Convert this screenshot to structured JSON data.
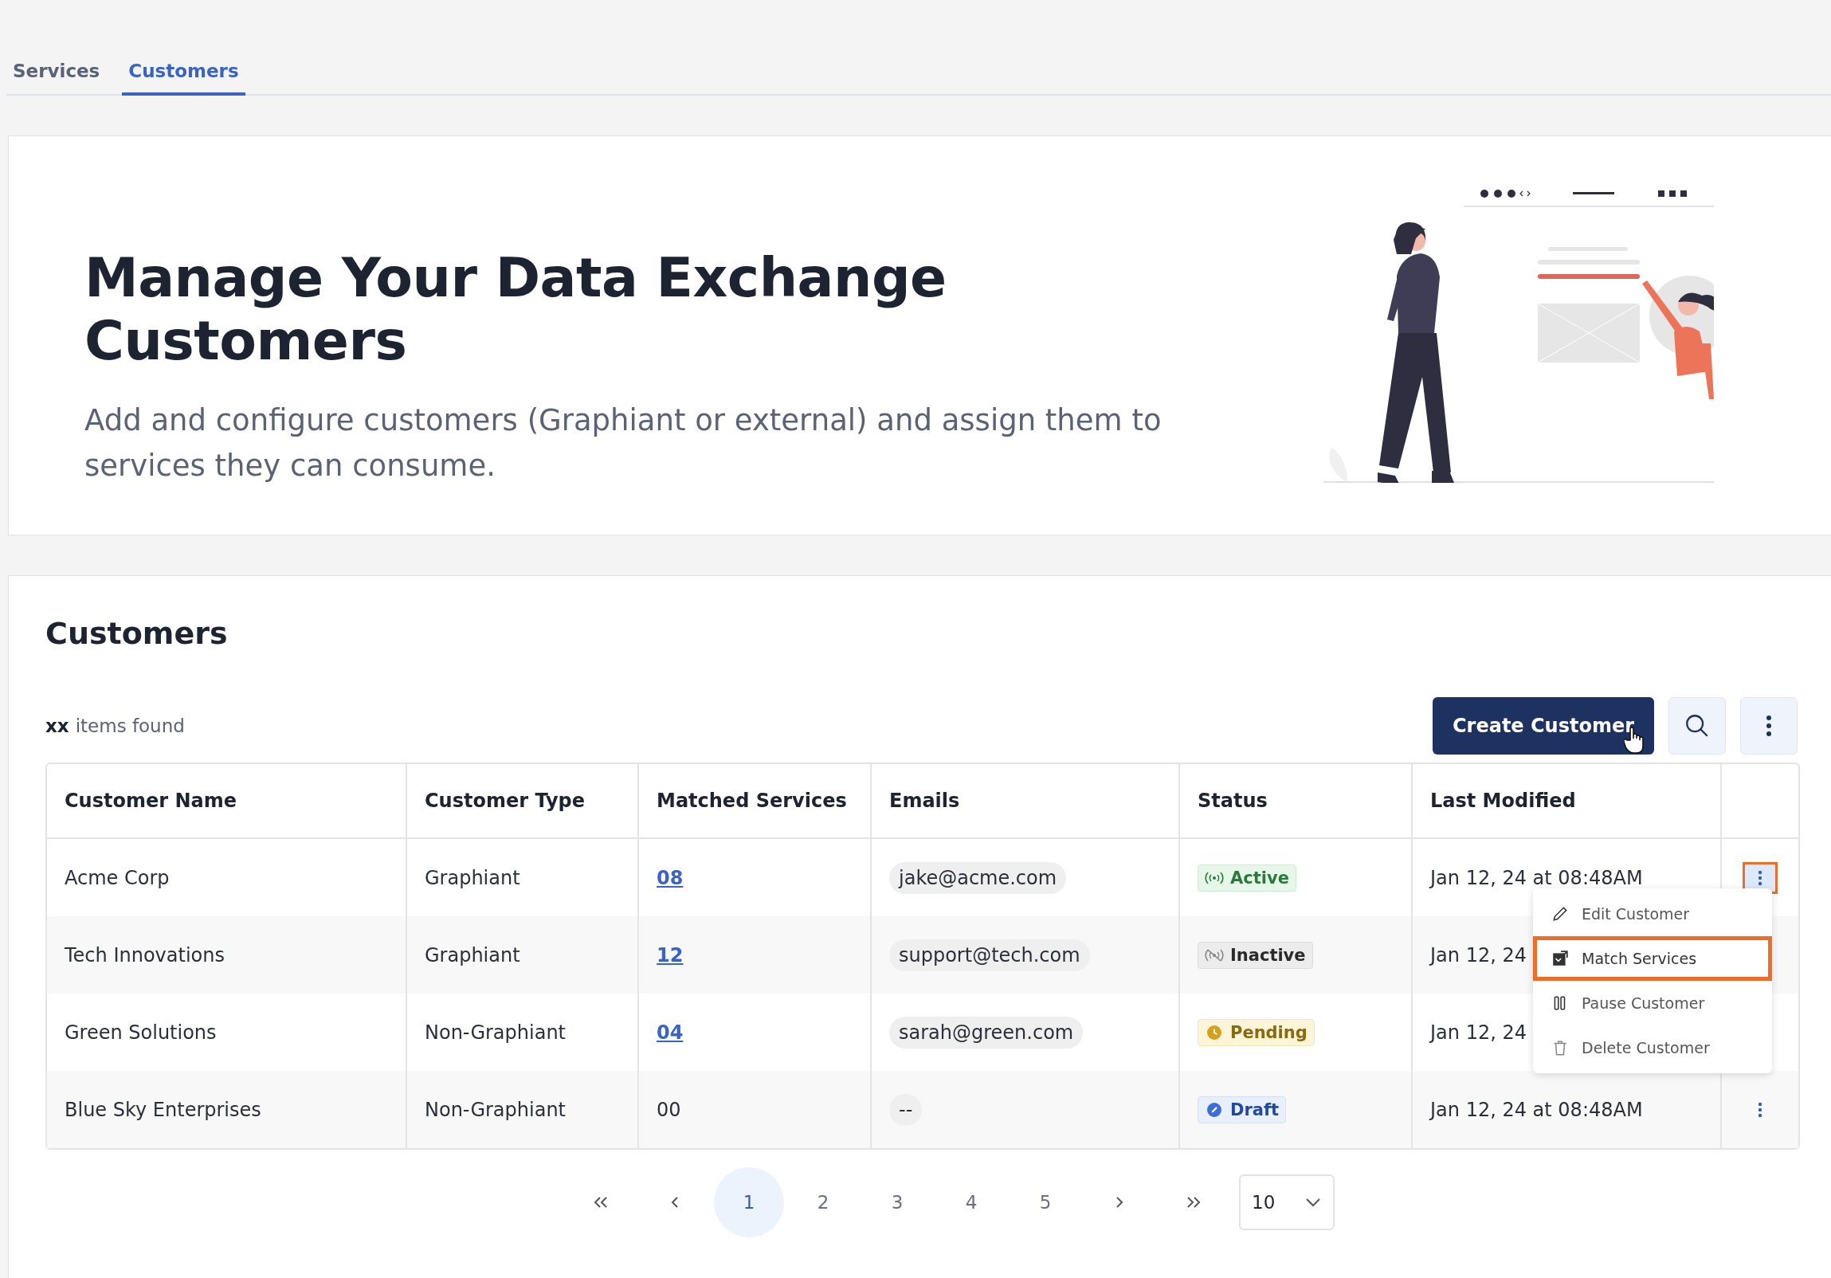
{
  "tabs": [
    {
      "label": "Services",
      "selected": false
    },
    {
      "label": "Customers",
      "selected": true
    }
  ],
  "hero": {
    "title": "Manage Your Data Exchange Customers",
    "subtitle": "Add and configure customers (Graphiant or external) and assign them to services they can consume."
  },
  "customers": {
    "title": "Customers",
    "count": "xx",
    "count_label": "items found",
    "create_button": "Create Customer",
    "columns": [
      "Customer Name",
      "Customer Type",
      "Matched Services",
      "Emails",
      "Status",
      "Last Modified"
    ],
    "rows": [
      {
        "name": "Acme Corp",
        "type": "Graphiant",
        "matched": "08",
        "linked": true,
        "email": "jake@acme.com",
        "status": {
          "label": "Active",
          "kind": "active"
        },
        "modified": "Jan 12, 24 at 08:48AM",
        "menu_open": true
      },
      {
        "name": "Tech Innovations",
        "type": "Graphiant",
        "matched": "12",
        "linked": true,
        "email": "support@tech.com",
        "status": {
          "label": "Inactive",
          "kind": "inactive"
        },
        "modified": "Jan 12, 24"
      },
      {
        "name": "Green Solutions",
        "type": "Non-Graphiant",
        "matched": "04",
        "linked": true,
        "email": "sarah@green.com",
        "status": {
          "label": "Pending",
          "kind": "pending"
        },
        "modified": "Jan 12, 24"
      },
      {
        "name": "Blue Sky Enterprises",
        "type": "Non-Graphiant",
        "matched": "00",
        "linked": false,
        "email": "--",
        "status": {
          "label": "Draft",
          "kind": "draft"
        },
        "modified": "Jan 12, 24 at 08:48AM",
        "menu_open": false
      }
    ],
    "row_menu": [
      {
        "label": "Edit Customer",
        "kind": "edit",
        "selected": false
      },
      {
        "label": "Match Services",
        "kind": "match",
        "selected": true
      },
      {
        "label": "Pause Customer",
        "kind": "pause",
        "selected": false
      },
      {
        "label": "Delete Customer",
        "kind": "delete",
        "selected": false
      }
    ],
    "pagination": {
      "pages": [
        {
          "label": "1",
          "selected": true
        },
        {
          "label": "2",
          "selected": false
        },
        {
          "label": "3",
          "selected": false
        },
        {
          "label": "4",
          "selected": false
        },
        {
          "label": "5",
          "selected": false
        }
      ],
      "page_size": "10"
    }
  }
}
